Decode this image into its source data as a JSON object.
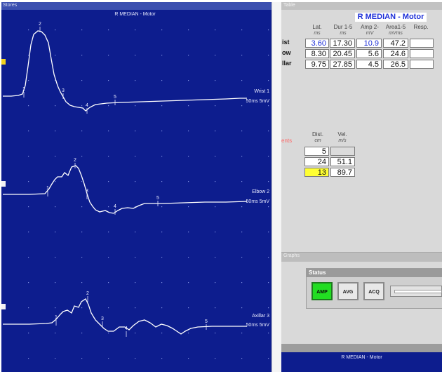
{
  "left_panel": {
    "title": "Stores",
    "trace_title": "R MEDIAN - Motor",
    "traces": [
      {
        "name": "Wrist 1",
        "scale": "50ms 5mV"
      },
      {
        "name": "Elbow 2",
        "scale": "50ms 5mV"
      },
      {
        "name": "Axillar 3",
        "scale": "50ms 5mV"
      }
    ],
    "marker_labels": [
      "1",
      "2",
      "3",
      "4",
      "5"
    ],
    "colors": {
      "background": "#0d1d8e",
      "trace": "#ffffff",
      "grid_dots": "#7f8fe0",
      "marker": "#f2d21c"
    }
  },
  "table": {
    "tab_label": "Table",
    "title": "R MEDIAN - Motor",
    "columns": [
      {
        "label": "Lat.",
        "unit": "ms"
      },
      {
        "label": "Dur 1-5",
        "unit": "ms"
      },
      {
        "label": "Amp 2-",
        "unit": "mV"
      },
      {
        "label": "Area1-5",
        "unit": "mVms"
      },
      {
        "label": "Resp.",
        "unit": ""
      }
    ],
    "rows": [
      {
        "label": "ist",
        "values": [
          "3.60",
          "17.30",
          "10.9",
          "47.2",
          ""
        ]
      },
      {
        "label": "ow",
        "values": [
          "8.30",
          "20.45",
          "5.6",
          "24.6",
          ""
        ]
      },
      {
        "label": "llar",
        "values": [
          "9.75",
          "27.85",
          "4.5",
          "26.5",
          ""
        ]
      }
    ],
    "segments_label": "ents",
    "segment_columns": [
      {
        "label": "Dist.",
        "unit": "cm"
      },
      {
        "label": "Vel.",
        "unit": "m/s"
      }
    ],
    "segments": [
      {
        "dist": "5",
        "vel": ""
      },
      {
        "dist": "24",
        "vel": "51.1"
      },
      {
        "dist": "13",
        "vel": "89.7"
      }
    ]
  },
  "graphs": {
    "bar_label": "Graphs",
    "status_label": "Status",
    "buttons": [
      "AMP",
      "AVG",
      "ACQ"
    ],
    "active_button": "AMP",
    "colors": {
      "active": "#22dd22"
    }
  },
  "bottom_panel": {
    "title": "R MEDIAN - Motor"
  }
}
